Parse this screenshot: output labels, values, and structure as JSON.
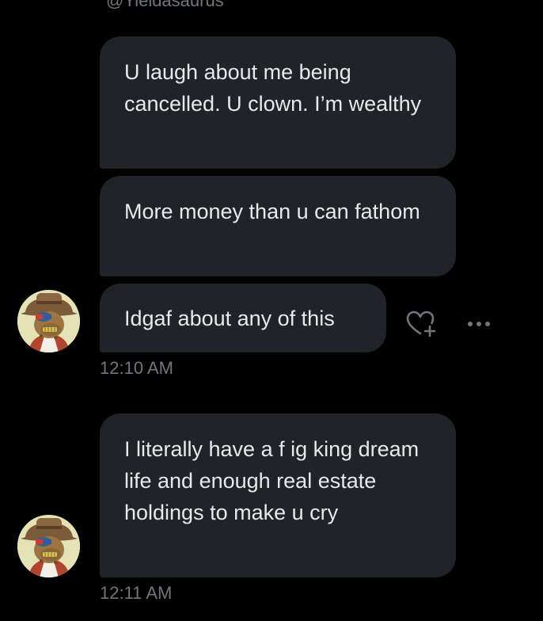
{
  "conversation": {
    "partial_handle": "@Yieldasaurus",
    "messages": [
      {
        "text": "U laugh about me being cancelled. U clown. I’m wealthy"
      },
      {
        "text": "More money than u can fathom"
      },
      {
        "text": "Idgaf about any of this"
      },
      {
        "text": "I literally have a f ig king dream life and enough real estate holdings to make u cry"
      }
    ],
    "timestamps": [
      "12:10 AM",
      "12:11 AM"
    ]
  },
  "icons": {
    "react": "heart-plus-icon",
    "more": "more-horizontal-icon",
    "avatar": "ape-avatar"
  },
  "colors": {
    "background": "#000000",
    "bubble": "#202327",
    "text": "#e7e9ea",
    "muted": "#71767b"
  }
}
